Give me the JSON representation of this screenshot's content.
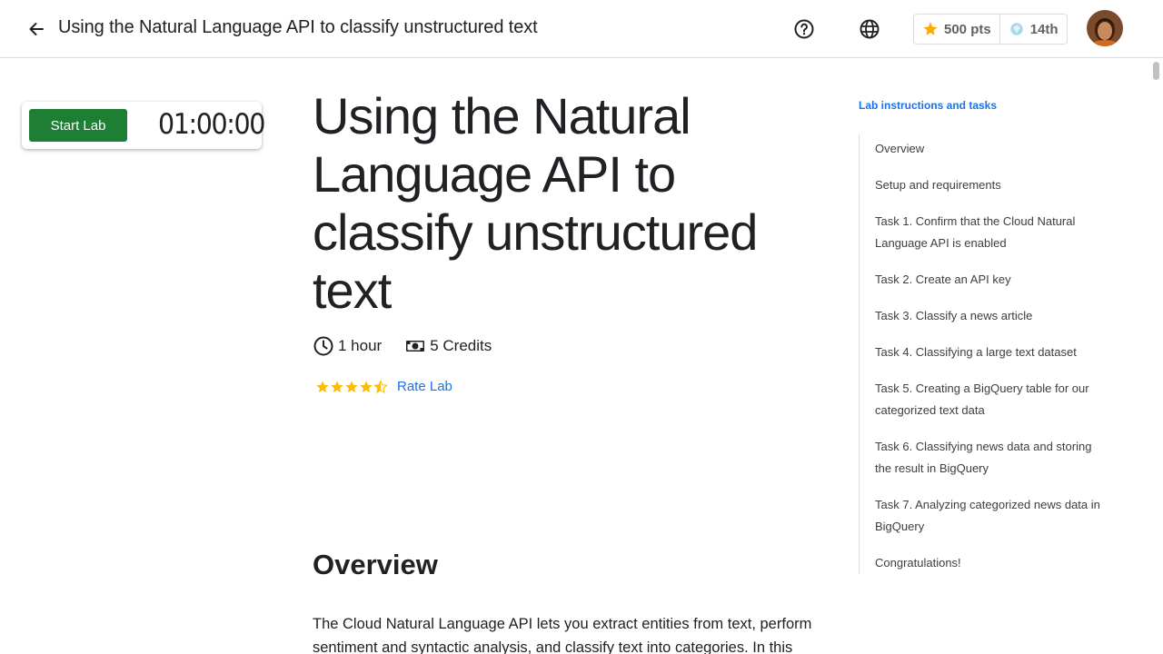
{
  "header": {
    "title": "Using the Natural Language API to classify unstructured text",
    "points": "500 pts",
    "rank": "14th"
  },
  "lab_card": {
    "start_label": "Start Lab",
    "timer": "01:00:00"
  },
  "main": {
    "title": "Using the Natural Language API to classify unstructured text",
    "duration": "1 hour",
    "credits": "5 Credits",
    "rating": 4.5,
    "rate_label": "Rate Lab",
    "section_heading": "Overview",
    "paragraph": "The Cloud Natural Language API lets you extract entities from text, perform sentiment and syntactic analysis, and classify text into categories. In this"
  },
  "toc": {
    "heading": "Lab instructions and tasks",
    "items": [
      {
        "label": "Overview"
      },
      {
        "label": "Setup and requirements"
      },
      {
        "label": "Task 1. Confirm that the Cloud Natural Language API is enabled"
      },
      {
        "label": "Task 2. Create an API key"
      },
      {
        "label": "Task 3. Classify a news article"
      },
      {
        "label": "Task 4. Classifying a large text dataset"
      },
      {
        "label": "Task 5. Creating a BigQuery table for our categorized text data"
      },
      {
        "label": "Task 6. Classifying news data and storing the result in BigQuery"
      },
      {
        "label": "Task 7. Analyzing categorized news data in BigQuery"
      },
      {
        "label": "Congratulations!"
      }
    ]
  },
  "colors": {
    "accent": "#1a73e8",
    "start_button": "#1e7e34",
    "star": "#fbbc04"
  },
  "icons": {
    "back": "arrow-left-icon",
    "help": "help-circle-icon",
    "language": "globe-icon",
    "points": "star-icon",
    "rank": "gem-icon",
    "duration": "clock-icon",
    "credits": "money-icon"
  }
}
